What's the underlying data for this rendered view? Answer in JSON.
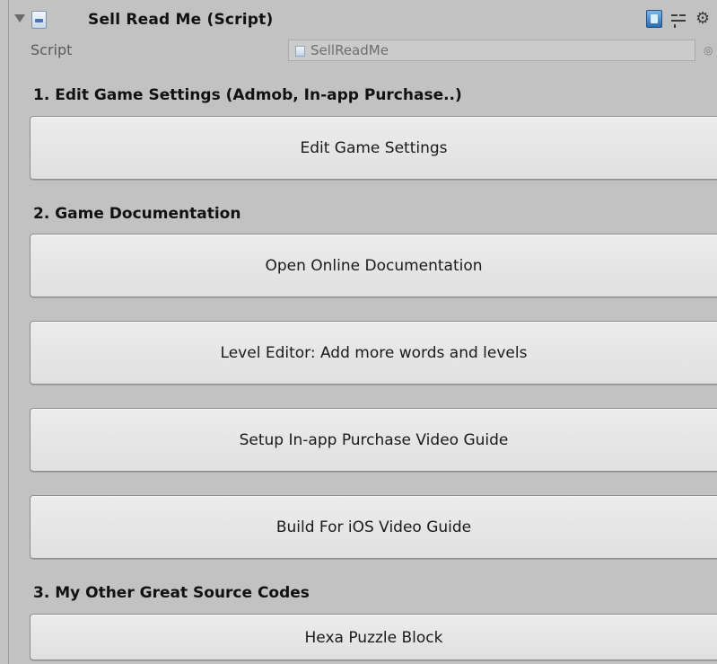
{
  "header": {
    "title": "Sell Read Me (Script)",
    "icons": [
      "foldout-arrow-icon",
      "script-icon",
      "help-icon",
      "preset-icon",
      "gear-icon"
    ]
  },
  "script_field": {
    "label": "Script",
    "value": "SellReadMe"
  },
  "sections": {
    "s1": "1. Edit Game Settings (Admob, In-app Purchase..)",
    "s2": "2. Game Documentation",
    "s3": "3. My Other Great Source Codes"
  },
  "buttons": {
    "edit_game_settings": "Edit Game Settings",
    "online_docs": "Open Online Documentation",
    "level_editor": "Level Editor: Add more words and levels",
    "iap_guide": "Setup In-app Purchase Video Guide",
    "ios_guide": "Build For iOS Video Guide",
    "hexa_puzzle": "Hexa Puzzle Block"
  },
  "colors": {
    "background": "#c2c2c2",
    "button": "#e6e6e6",
    "text": "#111111"
  }
}
